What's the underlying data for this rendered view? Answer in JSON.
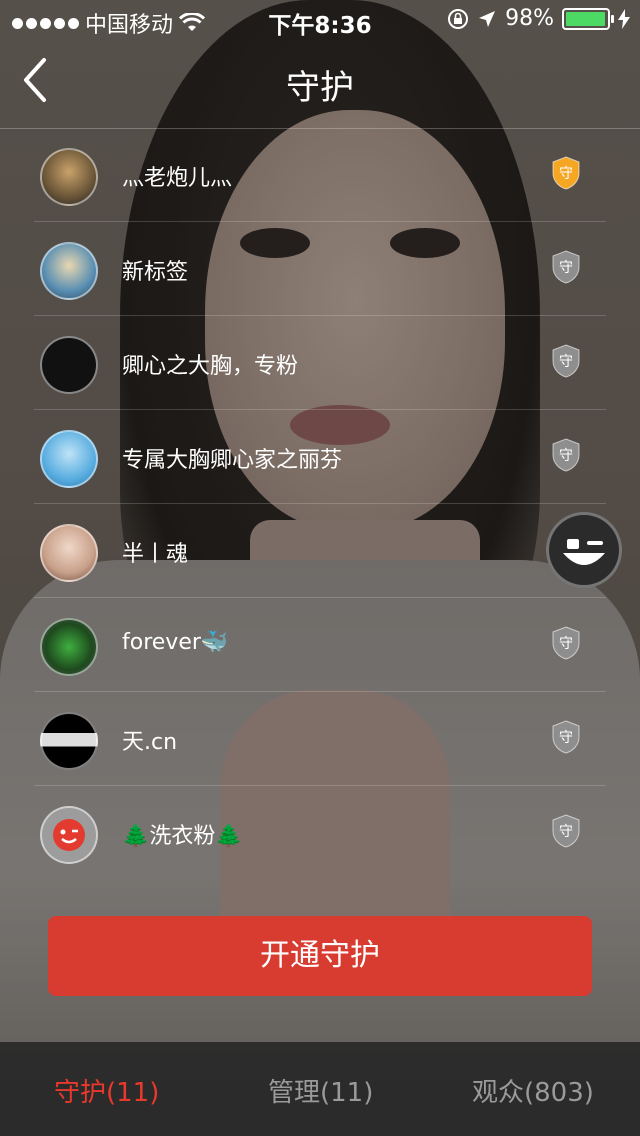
{
  "status_bar": {
    "carrier": "中国移动",
    "time": "下午8:36",
    "battery": "98%",
    "battery_level": 0.98
  },
  "nav": {
    "title": "守护",
    "back_icon": "chevron-left-icon"
  },
  "guardians": [
    {
      "name": "灬老炮儿灬",
      "badge": "守",
      "badge_color": "#f5a623"
    },
    {
      "name": "新标签",
      "badge": "守",
      "badge_color": "#8e8e8e"
    },
    {
      "name": "卿心之大胸，专粉",
      "badge": "守",
      "badge_color": "#8e8e8e"
    },
    {
      "name": "专属大胸卿心家之丽芬",
      "badge": "守",
      "badge_color": "#8e8e8e"
    },
    {
      "name": "半丨魂",
      "badge": "守",
      "badge_color": "#8e8e8e"
    },
    {
      "name": "forever🐳",
      "badge": "守",
      "badge_color": "#8e8e8e"
    },
    {
      "name": "天.cn",
      "badge": "守",
      "badge_color": "#8e8e8e"
    },
    {
      "name": "🌲洗衣粉🌲",
      "badge": "守",
      "badge_color": "#8e8e8e"
    }
  ],
  "cta": {
    "label": "开通守护",
    "color": "#d83b30"
  },
  "tabs": [
    {
      "label": "守护(11)",
      "active": true
    },
    {
      "label": "管理(11)",
      "active": false
    },
    {
      "label": "观众(803)",
      "active": false
    }
  ],
  "accent_color": "#e8392c"
}
